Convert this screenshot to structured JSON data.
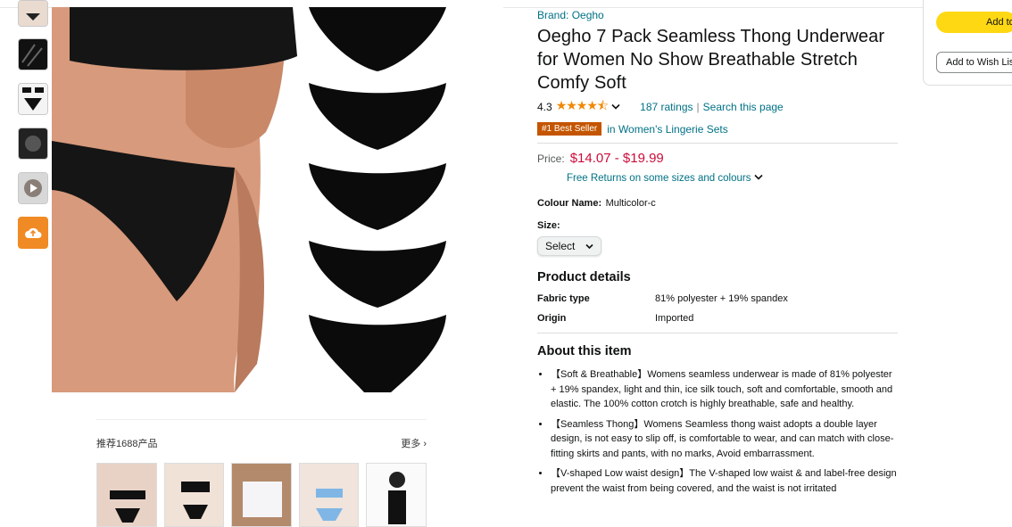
{
  "brand": "Brand: Oegho",
  "title": "Oegho 7 Pack Seamless Thong Underwear for Women No Show Breathable Stretch Comfy Soft",
  "rating": {
    "value": "4.3",
    "stars": "★★★★⯪",
    "count": "187 ratings",
    "separator": "|",
    "search": "Search this page"
  },
  "best_seller": {
    "badge": "#1 Best Seller",
    "category": "in Women's Lingerie Sets"
  },
  "price": {
    "label": "Price:",
    "value": "$14.07 - $19.99",
    "returns": "Free Returns on some sizes and colours"
  },
  "colour": {
    "label": "Colour Name:",
    "value": "Multicolor-c"
  },
  "size": {
    "label": "Size:",
    "select": "Select"
  },
  "product_details": {
    "heading": "Product details",
    "rows": [
      {
        "key": "Fabric type",
        "value": "81% polyester + 19% spandex"
      },
      {
        "key": "Origin",
        "value": "Imported"
      }
    ]
  },
  "about": {
    "heading": "About this item",
    "bullets": [
      "【Soft & Breathable】Womens seamless underwear is made of 81% polyester + 19% spandex, light and thin, ice silk touch, soft and comfortable, smooth and elastic. The 100% cotton crotch is highly breathable, safe and healthy.",
      "【Seamless Thong】Womens Seamless thong waist adopts a double layer design, is not easy to slip off, is comfortable to wear, and can match with close-fitting skirts and pants, with no marks, Avoid embarrassment.",
      "【V-shaped Low waist design】The V-shaped low waist & and label-free design prevent the waist from being covered, and the waist is not irritated"
    ]
  },
  "buybox": {
    "add_to_cart": "Add to",
    "wishlist": "Add to Wish List"
  },
  "recommend": {
    "title": "推荐1688产品",
    "more": "更多 ›"
  }
}
